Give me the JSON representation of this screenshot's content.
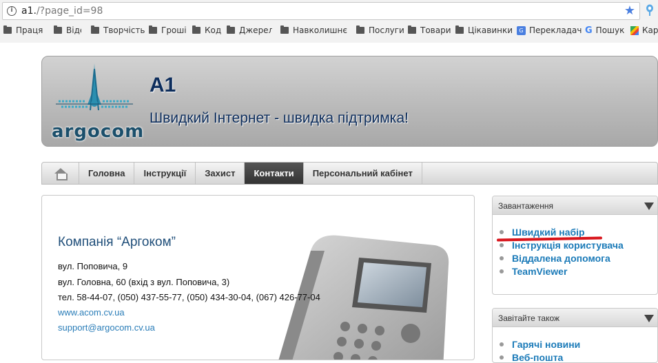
{
  "browser": {
    "url_main": "a1.",
    "url_rest": "/?page_id=98",
    "bookmarks": [
      "Праця",
      "Відео",
      "Творчість",
      "Гроші",
      "Код",
      "Джерела",
      "Навколишнє",
      "Послуги",
      "Товари",
      "Цікавинки",
      "Перекладач",
      "Пошук",
      "Карт"
    ]
  },
  "site": {
    "logo_text": "argocom",
    "title": "A1",
    "slogan": "Швидкий Інтернет - швидка підтримка!"
  },
  "nav": {
    "items": [
      "Головна",
      "Інструкції",
      "Захист",
      "Контакти",
      "Персональний кабінет"
    ],
    "active": "Контакти"
  },
  "contacts": {
    "company": "Компанія “Аргоком”",
    "address1": "вул. Поповича, 9",
    "address2": "вул. Головна, 60 (вхід з вул. Поповича, 3)",
    "phones": "тел. 58-44-07, (050) 437-55-77, (050) 434-30-04, (067) 426-77-04",
    "website": "www.acom.cv.ua",
    "email": "support@argocom.cv.ua"
  },
  "sidebar": {
    "downloads": {
      "title": "Завантаження",
      "items": [
        "Швидкий набір",
        "Інструкція користувача",
        "Віддалена допомога",
        "TeamViewer"
      ]
    },
    "also": {
      "title": "Завітайте також",
      "items": [
        "Гарячі новини",
        "Веб-пошта"
      ]
    }
  },
  "colors": {
    "link": "#1a7ab8",
    "heading": "#0d2d5c",
    "nav_active": "#333333",
    "annotation": "#d8141b"
  }
}
